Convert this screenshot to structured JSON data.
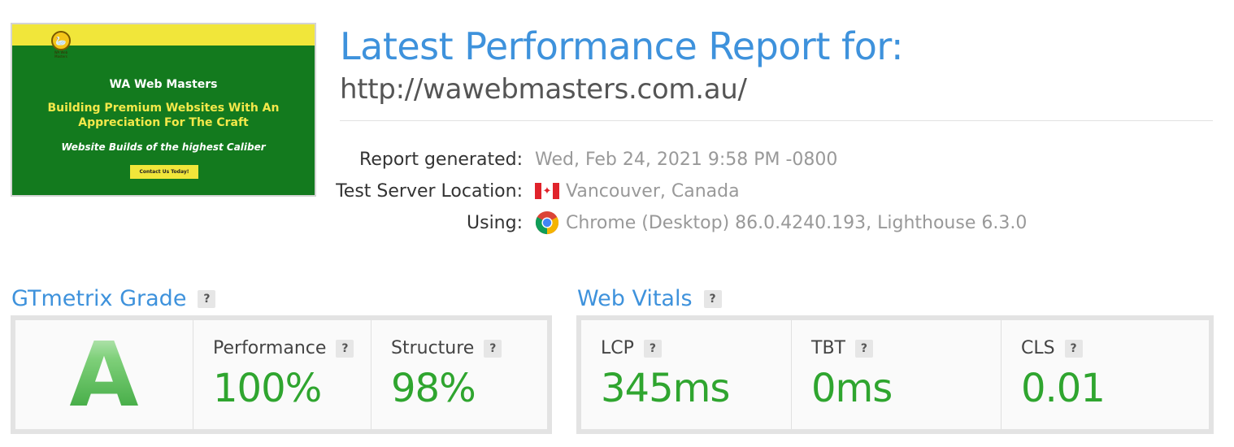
{
  "thumbnail": {
    "brand": "WA Web Masters",
    "logo_text": "WA Web Masters",
    "headline": "Building Premium Websites With An Appreciation For The Craft",
    "tagline": "Website Builds of the highest Caliber",
    "cta": "Contact Us Today!",
    "colors": {
      "bg": "#137a1e",
      "accent": "#f1e63a"
    }
  },
  "header": {
    "title": "Latest Performance Report for:",
    "url": "http://wawebmasters.com.au/"
  },
  "meta": {
    "report_generated_label": "Report generated:",
    "report_generated_value": "Wed, Feb 24, 2021 9:58 PM -0800",
    "location_label": "Test Server Location:",
    "location_value": "Vancouver, Canada",
    "location_icon": "canada-flag-icon",
    "using_label": "Using:",
    "using_value": "Chrome (Desktop) 86.0.4240.193, Lighthouse 6.3.0",
    "using_icon": "chrome-icon"
  },
  "grade": {
    "title": "GTmetrix Grade",
    "help": "?",
    "letter": "A",
    "performance_label": "Performance",
    "performance_value": "100%",
    "structure_label": "Structure",
    "structure_value": "98%"
  },
  "vitals": {
    "title": "Web Vitals",
    "help": "?",
    "lcp_label": "LCP",
    "lcp_value": "345ms",
    "tbt_label": "TBT",
    "tbt_value": "0ms",
    "cls_label": "CLS",
    "cls_value": "0.01"
  },
  "colors": {
    "heading": "#3e92dc",
    "good": "#2fa52f",
    "muted": "#999999"
  }
}
